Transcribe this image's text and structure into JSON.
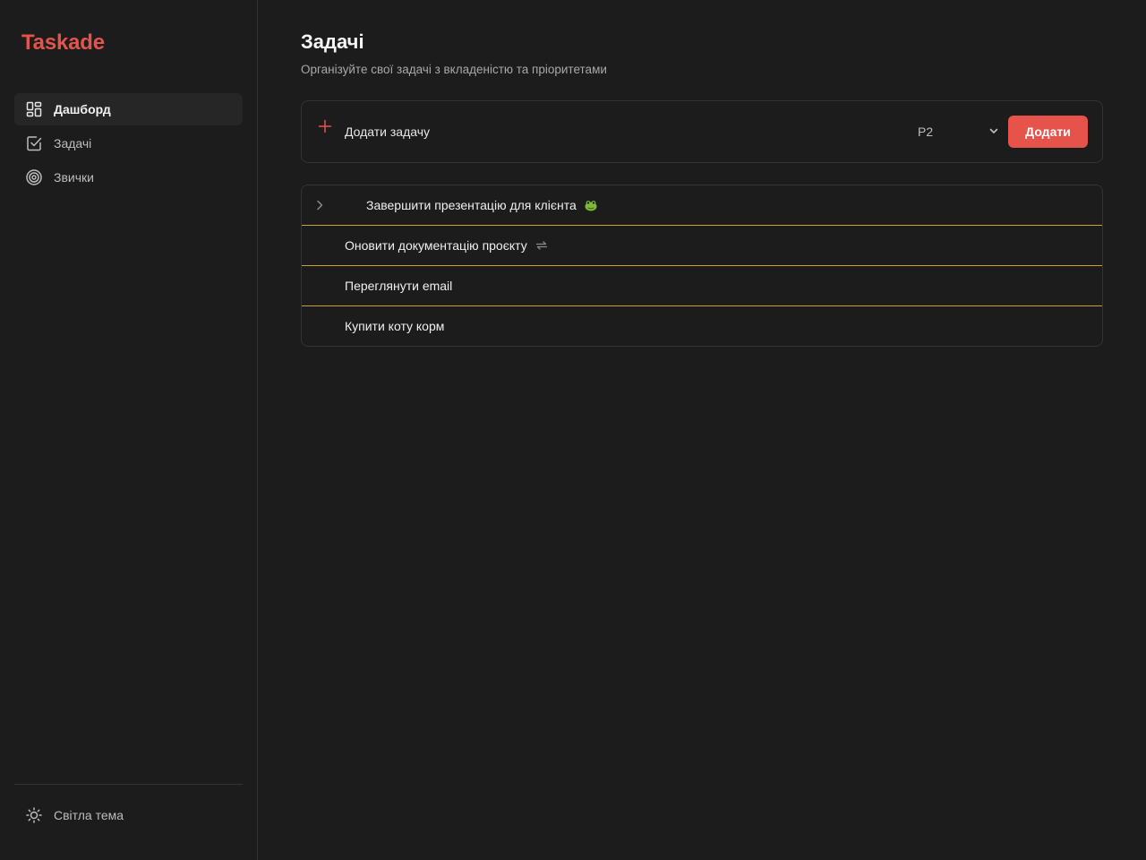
{
  "app": {
    "name": "Taskade"
  },
  "sidebar": {
    "items": [
      {
        "label": "Дашборд",
        "icon": "dashboard-icon",
        "active": true
      },
      {
        "label": "Задачі",
        "icon": "checkbox-icon",
        "active": false
      },
      {
        "label": "Звички",
        "icon": "target-icon",
        "active": false
      }
    ],
    "theme_toggle": {
      "label": "Світла тема",
      "icon": "sun-icon"
    }
  },
  "main": {
    "title": "Задачі",
    "subtitle": "Організуйте свої задачі з вкладеністю та пріоритетами",
    "add_task": {
      "placeholder": "Додати задачу",
      "priority": "P2",
      "button": "Додати"
    },
    "tasks": [
      {
        "title": "Завершити презентацію для клієнта",
        "expandable": true,
        "badge": "frog-icon"
      },
      {
        "title": "Оновити документацію проєкту",
        "expandable": false,
        "badge": "repeat-icon"
      },
      {
        "title": "Переглянути email",
        "expandable": false,
        "badge": ""
      },
      {
        "title": "Купити коту корм",
        "expandable": false,
        "badge": ""
      }
    ]
  },
  "colors": {
    "accent": "#e5534b",
    "background": "#1c1c1c",
    "task_separator": "#c9a227"
  }
}
